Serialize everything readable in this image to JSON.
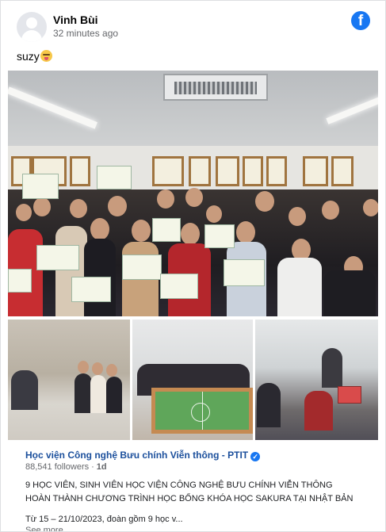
{
  "post": {
    "author": "Vinh Bùi",
    "timestamp": "32 minutes ago",
    "text": "suzy",
    "emoji": "squinting-tongue-face"
  },
  "brand": {
    "logo_letter": "f",
    "color": "#1877f2"
  },
  "shared": {
    "page_name": "Học viện Công nghệ Bưu chính Viễn thông - PTIT",
    "followers": "88,541 followers",
    "age": "1d",
    "headline": "9 HỌC VIÊN, SINH VIÊN HỌC VIỆN CÔNG NGHỆ BƯU CHÍNH VIỄN THÔNG HOÀN THÀNH CHƯƠNG TRÌNH HỌC BỔNG KHÓA HỌC SAKURA TẠI NHẬT BẢN",
    "snippet": "Từ 15 – 21/10/2023, đoàn gồm 9 học v...",
    "see_more": "See more"
  },
  "colors": {
    "link": "#1b4f9c",
    "secondary_text": "#65676b",
    "verified": "#1877f2"
  }
}
